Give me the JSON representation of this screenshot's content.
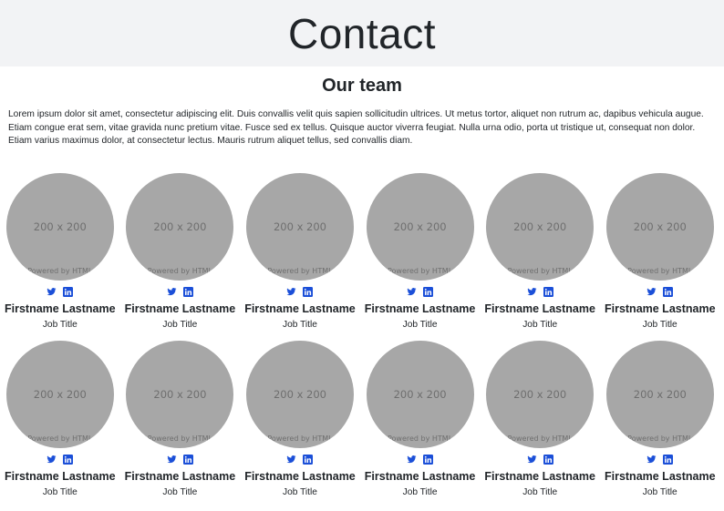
{
  "header": {
    "title": "Contact"
  },
  "team": {
    "heading": "Our team",
    "intro": "Lorem ipsum dolor sit amet, consectetur adipiscing elit. Duis convallis velit quis sapien sollicitudin ultrices. Ut metus tortor, aliquet non rutrum ac, dapibus vehicula augue. Etiam congue erat sem, vitae gravida nunc pretium vitae. Fusce sed ex tellus. Quisque auctor viverra feugiat. Nulla urna odio, porta ut tristique ut, consequat non dolor. Etiam varius maximus dolor, at consectetur lectus. Mauris rutrum aliquet tellus, sed convallis diam.",
    "placeholder": {
      "dims": "200 x 200",
      "watermark": "Powered by HTML"
    },
    "social_icons": [
      "twitter-icon",
      "linkedin-icon"
    ],
    "colors": {
      "placeholder_bg": "#a7a7a7",
      "icon_blue": "#1b4fd8",
      "hero_bg": "#f2f3f5"
    },
    "rows": [
      [
        {
          "name": "Firstname Lastname",
          "job": "Job Title"
        },
        {
          "name": "Firstname Lastname",
          "job": "Job Title"
        },
        {
          "name": "Firstname Lastname",
          "job": "Job Title"
        },
        {
          "name": "Firstname Lastname",
          "job": "Job Title"
        },
        {
          "name": "Firstname Lastname",
          "job": "Job Title"
        },
        {
          "name": "Firstname Lastname",
          "job": "Job Title"
        }
      ],
      [
        {
          "name": "Firstname Lastname",
          "job": "Job Title"
        },
        {
          "name": "Firstname Lastname",
          "job": "Job Title"
        },
        {
          "name": "Firstname Lastname",
          "job": "Job Title"
        },
        {
          "name": "Firstname Lastname",
          "job": "Job Title"
        },
        {
          "name": "Firstname Lastname",
          "job": "Job Title"
        },
        {
          "name": "Firstname Lastname",
          "job": "Job Title"
        }
      ]
    ]
  }
}
